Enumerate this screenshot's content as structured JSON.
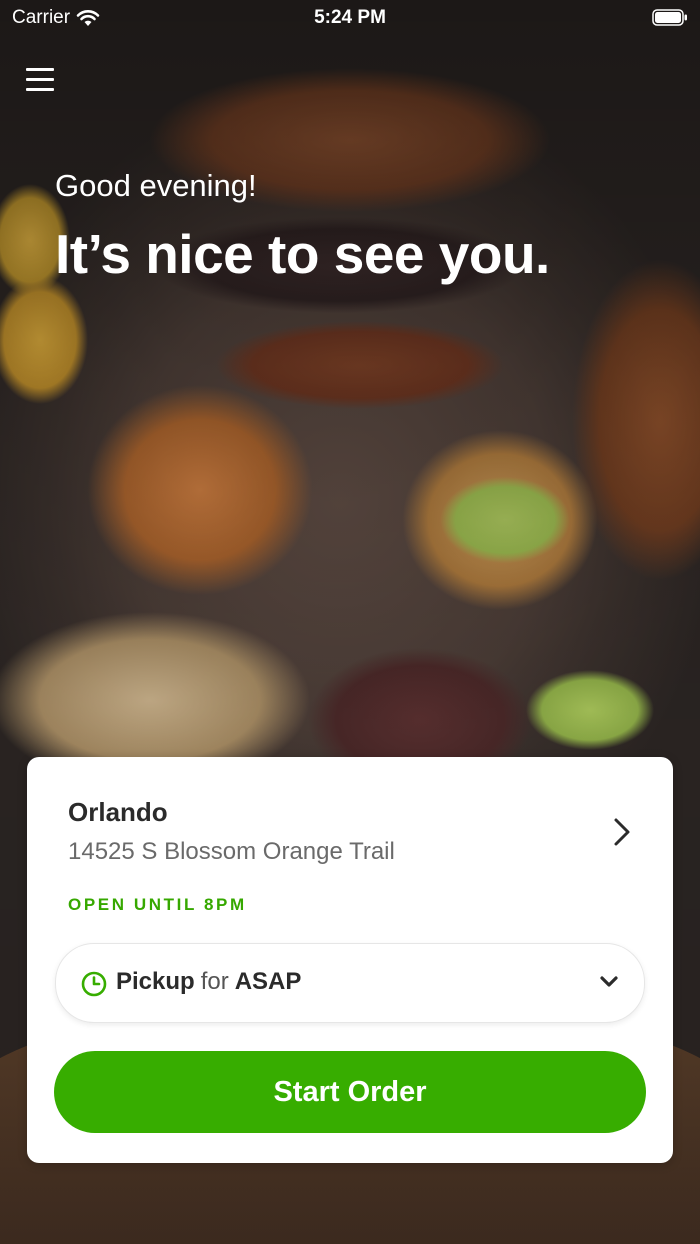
{
  "status_bar": {
    "carrier": "Carrier",
    "time": "5:24 PM"
  },
  "header": {
    "menu_icon": "hamburger-menu-icon",
    "greeting": "Good evening!",
    "headline": "It’s nice to see you."
  },
  "location_card": {
    "name": "Orlando",
    "address": "14525 S Blossom Orange Trail",
    "status": "OPEN UNTIL 8PM",
    "status_color": "#36a800",
    "order_type": {
      "mode": "Pickup",
      "connector": "for",
      "time": "ASAP",
      "icon": "clock-icon"
    },
    "start_button_label": "Start Order",
    "accent_color": "#37ad00"
  }
}
